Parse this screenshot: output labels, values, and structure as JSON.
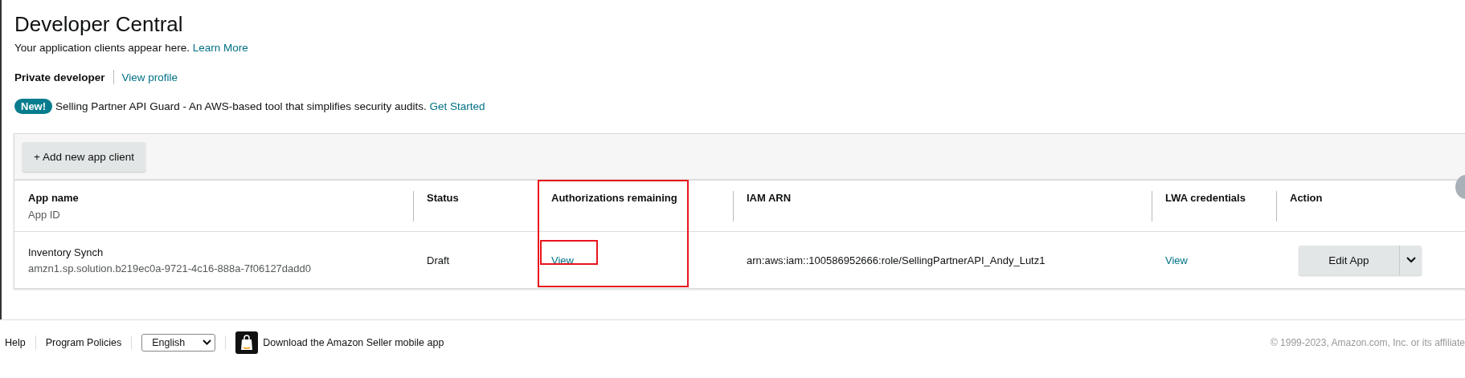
{
  "page": {
    "title": "Developer Central",
    "subtitle": "Your application clients appear here.",
    "subtitle_link": "Learn More"
  },
  "account": {
    "type": "Private developer",
    "link": "View profile"
  },
  "announcement": {
    "badge": "New!",
    "text": "Selling Partner API Guard - An AWS-based tool that simplifies security audits.",
    "link": "Get Started"
  },
  "toolbar": {
    "button": "+ Add new app client"
  },
  "table": {
    "columns": [
      {
        "label": "App name",
        "sublabel": "App ID",
        "highlighted": false
      },
      {
        "label": "Status",
        "highlighted": false
      },
      {
        "label": "Authorizations remaining",
        "highlighted": true
      },
      {
        "label": "IAM ARN",
        "highlighted": false
      },
      {
        "label": "LWA credentials",
        "highlighted": false
      },
      {
        "label": "Action",
        "highlighted": false
      }
    ],
    "rows": [
      {
        "cells": [
          {
            "kind": "stacked",
            "text": "Inventory Synch",
            "subtext": "amzn1.sp.solution.b219ec0a-9721-4c16-888a-7f06127dadd0",
            "highlighted": false
          },
          {
            "kind": "text",
            "text": "Draft",
            "highlighted": false
          },
          {
            "kind": "link",
            "text": "View",
            "highlighted": true
          },
          {
            "kind": "text",
            "text": "arn:aws:iam::100586952666:role/SellingPartnerAPI_Andy_Lutz1",
            "highlighted": false
          },
          {
            "kind": "link",
            "text": "View",
            "highlighted": false
          },
          {
            "kind": "split-button",
            "text": "Edit App",
            "highlighted": false
          }
        ]
      }
    ]
  },
  "footer": {
    "links": [
      "Help",
      "Program Policies"
    ],
    "language": "English",
    "app_promo": "Download the Amazon Seller mobile app",
    "copyright": "© 1999-2023, Amazon.com, Inc. or its affiliate"
  }
}
